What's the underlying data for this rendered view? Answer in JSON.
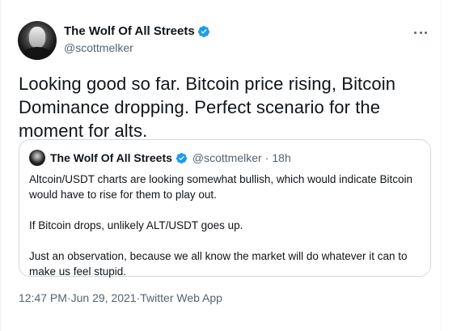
{
  "tweet": {
    "author": {
      "display_name": "The Wolf Of All Streets",
      "handle": "@scottmelker",
      "verified": true
    },
    "text": "Looking good so far. Bitcoin price rising, Bitcoin Dominance dropping. Perfect scenario for the moment for alts.",
    "menu_icon": "more-horizontal-icon",
    "meta": {
      "time": "12:47 PM",
      "separator": " · ",
      "date": "Jun 29, 2021",
      "source": "Twitter Web App"
    }
  },
  "quote": {
    "author": {
      "display_name": "The Wolf Of All Streets",
      "handle": "@scottmelker",
      "verified": true
    },
    "dot": "·",
    "age": "18h",
    "paragraphs": [
      "Altcoin/USDT charts are looking somewhat bullish, which would indicate Bitcoin would have to rise for them to play out.",
      "If Bitcoin drops, unlikely ALT/USDT goes up.",
      "Just an observation, because we all know the market will do whatever it can to make us feel stupid."
    ]
  },
  "colors": {
    "verified_blue": "#1d9bf0",
    "text_primary": "#0f1419",
    "text_secondary": "#536471",
    "border": "#cfd9de"
  }
}
